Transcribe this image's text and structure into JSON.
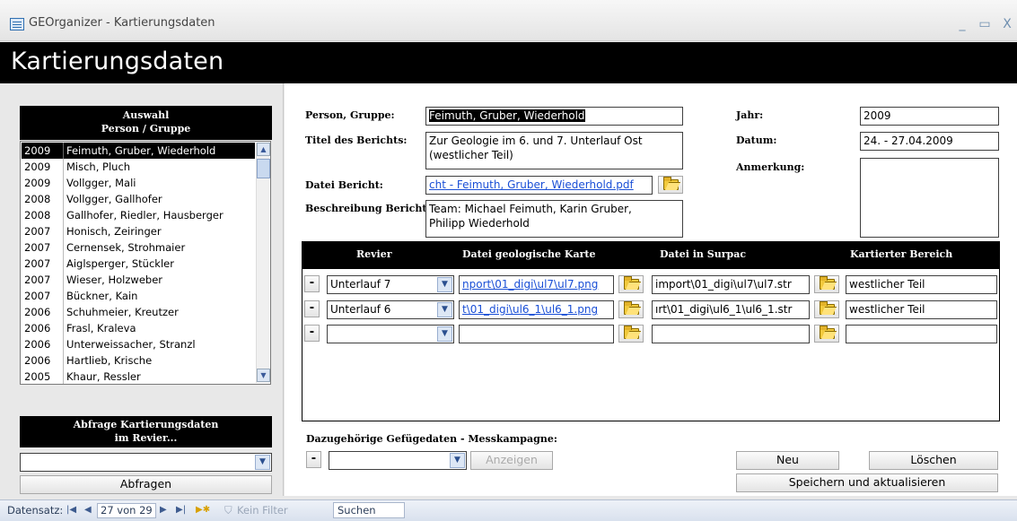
{
  "window": {
    "title": "GEOrganizer - Kartierungsdaten",
    "minimize": "_",
    "maximize": "▭",
    "close": "X"
  },
  "page": {
    "title": "Kartierungsdaten"
  },
  "left": {
    "selection_header_line1": "Auswahl",
    "selection_header_line2": "Person / Gruppe",
    "list": [
      {
        "year": "2009",
        "name": "Feimuth, Gruber, Wiederhold",
        "selected": true
      },
      {
        "year": "2009",
        "name": "Misch, Pluch"
      },
      {
        "year": "2009",
        "name": "Vollgger, Mali"
      },
      {
        "year": "2008",
        "name": "Vollgger, Gallhofer"
      },
      {
        "year": "2008",
        "name": "Gallhofer, Riedler, Hausberger"
      },
      {
        "year": "2007",
        "name": "Honisch, Zeiringer"
      },
      {
        "year": "2007",
        "name": "Cernensek, Strohmaier"
      },
      {
        "year": "2007",
        "name": "Aiglsperger, Stückler"
      },
      {
        "year": "2007",
        "name": "Wieser, Holzweber"
      },
      {
        "year": "2007",
        "name": "Bückner, Kain"
      },
      {
        "year": "2006",
        "name": "Schuhmeier, Kreutzer"
      },
      {
        "year": "2006",
        "name": "Frasl, Kraleva"
      },
      {
        "year": "2006",
        "name": "Unterweissacher, Stranzl"
      },
      {
        "year": "2006",
        "name": "Hartlieb, Krische"
      },
      {
        "year": "2005",
        "name": "Khaur, Ressler"
      }
    ],
    "query_header_line1": "Abfrage Kartierungsdaten",
    "query_header_line2": "im Revier...",
    "query_value": "",
    "query_button": "Abfragen"
  },
  "form": {
    "person_label": "Person, Gruppe:",
    "person_value": "Feimuth, Gruber, Wiederhold",
    "title_label": "Titel des Berichts:",
    "title_value_line1": "Zur Geologie im 6. und 7. Unterlauf Ost",
    "title_value_line2": "(westlicher Teil)",
    "file_label": "Datei Bericht:",
    "file_value": "cht - Feimuth, Gruber, Wiederhold.pdf",
    "desc_label": "Beschreibung Bericht:",
    "desc_value_line1": "Team: Michael Feimuth, Karin Gruber,",
    "desc_value_line2": "Philipp Wiederhold",
    "year_label": "Jahr:",
    "year_value": "2009",
    "date_label": "Datum:",
    "date_value": "24. - 27.04.2009",
    "note_label": "Anmerkung:",
    "note_value": ""
  },
  "grid": {
    "headers": [
      "Revier",
      "Datei geologische Karte",
      "Datei in Surpac",
      "Kartierter Bereich"
    ],
    "rows": [
      {
        "revier": "Unterlauf 7",
        "map": "nport\\01_digi\\ul7\\ul7.png",
        "surpac": "import\\01_digi\\ul7\\ul7.str",
        "area": "westlicher Teil"
      },
      {
        "revier": "Unterlauf 6",
        "map": "t\\01_digi\\ul6_1\\ul6_1.png",
        "surpac": "ırt\\01_digi\\ul6_1\\ul6_1.str",
        "area": "westlicher Teil"
      },
      {
        "revier": "",
        "map": "",
        "surpac": "",
        "area": ""
      }
    ],
    "minus": "-"
  },
  "bottom": {
    "fabric_label": "Dazugehörige Gefügedaten - Messkampagne:",
    "fabric_value": "",
    "show_button": "Anzeigen",
    "new_button": "Neu",
    "delete_button": "Löschen",
    "save_button": "Speichern und aktualisieren"
  },
  "status": {
    "record_label": "Datensatz:",
    "record_value": "27 von 29",
    "filter": "Kein Filter",
    "search": "Suchen"
  }
}
